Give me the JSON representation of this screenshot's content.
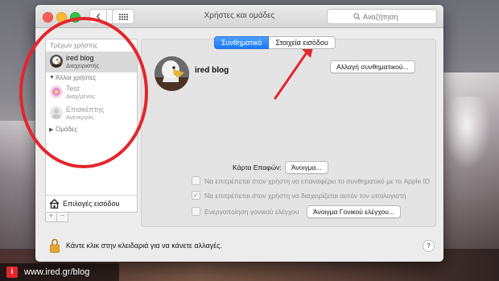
{
  "window": {
    "title": "Χρήστες και ομάδες",
    "search_placeholder": "Αναζήτηση"
  },
  "sidebar": {
    "current_user_label": "Τρέχων χρήστης",
    "current_user": {
      "name": "ired blog",
      "role": "Διαχειριστής"
    },
    "other_users_label": "Άλλοι χρήστες",
    "other_users": [
      {
        "name": "Test",
        "role": "Διαχ/μενος"
      },
      {
        "name": "Επισκέπτης",
        "role": "Ανενεργός"
      }
    ],
    "groups_label": "Ομάδες",
    "login_options_label": "Επιλογές εισόδου",
    "add_symbol": "+",
    "remove_symbol": "−"
  },
  "tabs": [
    {
      "label": "Συνθηματικό",
      "active": true
    },
    {
      "label": "Στοιχεία εισόδου",
      "active": false
    }
  ],
  "main": {
    "user_name": "ired blog",
    "change_password_button": "Αλλαγή συνθηματικού...",
    "contact_card_label": "Κάρτα Επαφών:",
    "open_button": "Άνοιγμα...",
    "checkbox_reset_appleid": {
      "label": "Να επιτρέπεται στον χρήστη να επαναφέρει το συνθηματικό με το Apple ID",
      "checked": false
    },
    "checkbox_admin": {
      "label": "Να επιτρέπεται στον χρήστη να διαχειρίζεται αυτόν τον υπολογιστή",
      "checked": true,
      "check_glyph": "✓"
    },
    "checkbox_parental": {
      "label": "Ενεργοποίηση γονικού ελέγχου",
      "checked": false
    },
    "parental_button": "Άνοιγμα Γονικού ελέγχου..."
  },
  "footer": {
    "lock_text": "Κάντε κλικ στην κλειδαριά για να κάνετε αλλαγές.",
    "help_symbol": "?"
  },
  "watermark": {
    "logo_letter": "i",
    "text": "www.ired.gr/blog"
  },
  "annotation_color": "#e3262c",
  "accent_color": "#1c7bf2"
}
